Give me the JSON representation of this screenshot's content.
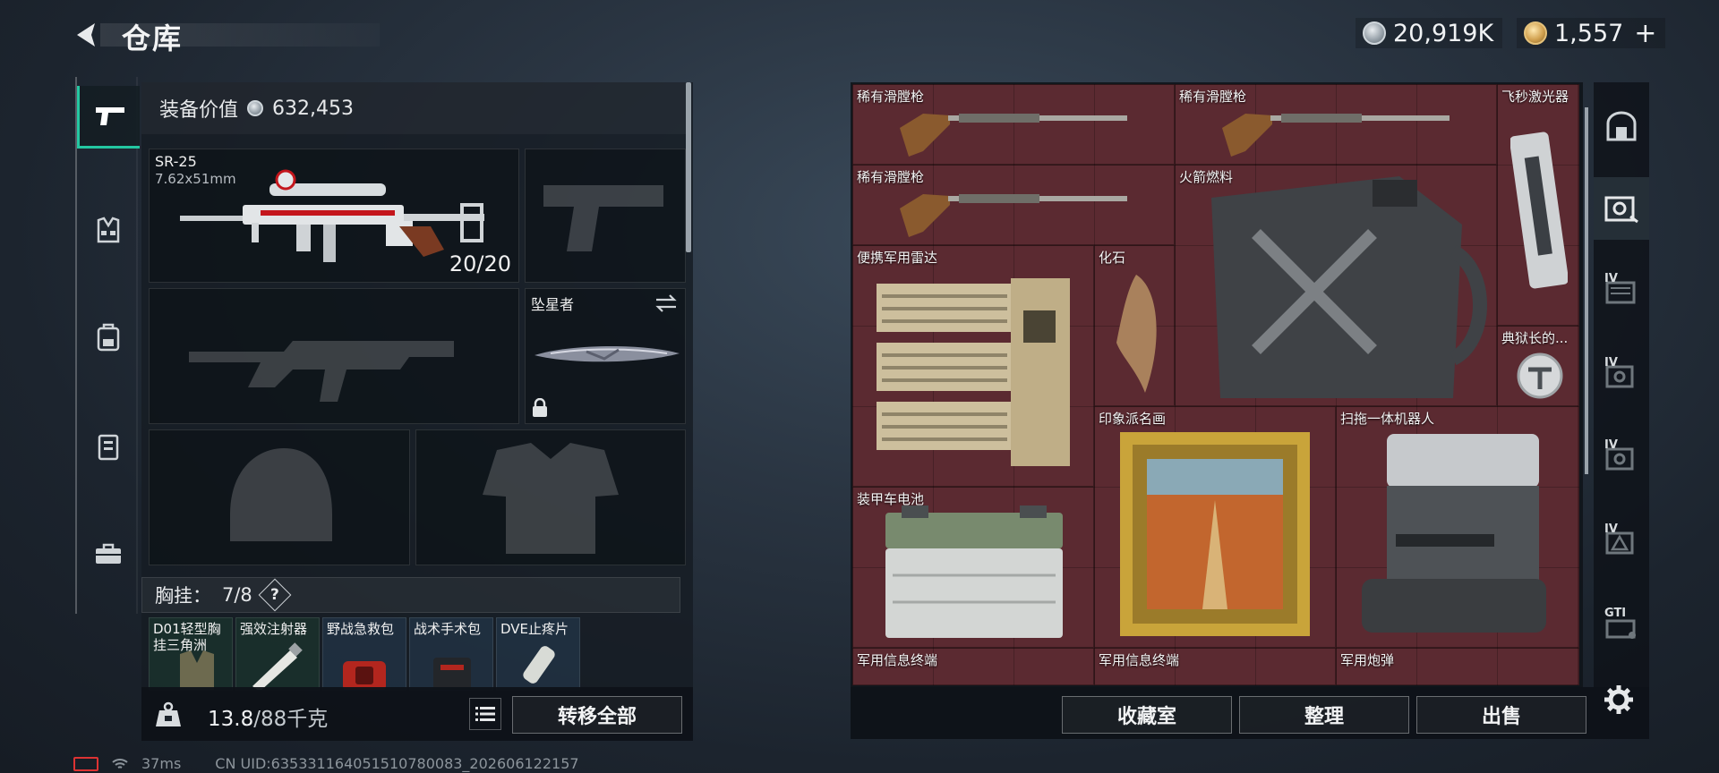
{
  "header": {
    "title": "仓库",
    "currency_silver": "20,919K",
    "currency_gold": "1,557",
    "plus": "+"
  },
  "loadout": {
    "value_label": "装备价值",
    "value": "632,453",
    "primary_weapon": {
      "name": "SR-25",
      "caliber": "7.62x51mm",
      "ammo": "20/20"
    },
    "melee": {
      "name": "坠星者"
    },
    "chest_rig": {
      "label": "胸挂：",
      "capacity": "7/8",
      "help": "?"
    },
    "rig_items": [
      {
        "name": "D01轻型胸挂三角洲"
      },
      {
        "name": "强效注射器"
      },
      {
        "name": "野战急救包"
      },
      {
        "name": "战术手术包"
      },
      {
        "name": "DVE止疼片"
      }
    ],
    "weight": "13.8",
    "weight_max": "/88千克",
    "transfer_all": "转移全部"
  },
  "storage": {
    "items": [
      {
        "name": "稀有滑膛枪"
      },
      {
        "name": "稀有滑膛枪"
      },
      {
        "name": "飞秒激光器"
      },
      {
        "name": "稀有滑膛枪"
      },
      {
        "name": "火箭燃料"
      },
      {
        "name": "便携军用雷达"
      },
      {
        "name": "化石"
      },
      {
        "name": "典狱长的..."
      },
      {
        "name": "印象派名画"
      },
      {
        "name": "扫拖一体机器人"
      },
      {
        "name": "装甲车电池"
      },
      {
        "name": "军用信息终端"
      },
      {
        "name": "军用信息终端"
      },
      {
        "name": "军用炮弹"
      }
    ],
    "rail_badges": [
      "IV",
      "IV",
      "IV",
      "IV",
      "GTI"
    ],
    "buttons": {
      "collection": "收藏室",
      "organize": "整理",
      "sell": "出售"
    }
  },
  "status": {
    "ping": "37ms",
    "uid": "CN UID:635331164051510780083_202606122157"
  }
}
